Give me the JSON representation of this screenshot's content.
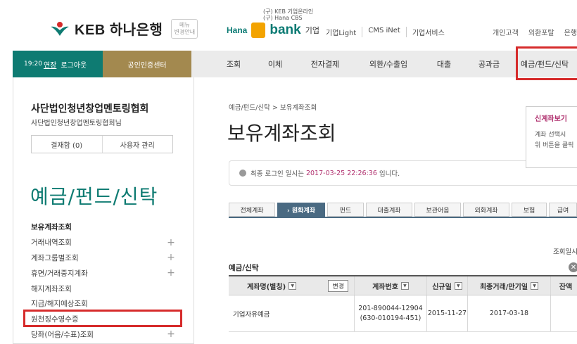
{
  "header": {
    "logo_text": "KEB 하나은행",
    "logo_badge": "메뉴\n변경안내",
    "hanabank": {
      "small_line1": "(구) KEB 기업온라인",
      "small_line2": "(구) Hana CBS",
      "hana": "Hana",
      "bank": "bank",
      "corp": "기업"
    },
    "links": [
      "기업Light",
      "CMS iNet",
      "기업서비스"
    ],
    "right_links": [
      "개인고객",
      "외환포탈",
      "은행"
    ]
  },
  "nav": {
    "time": "19:20",
    "extend": "연장",
    "logout": "로그아웃",
    "cert_center": "공인인증센터",
    "items": [
      "조회",
      "이체",
      "전자결제",
      "외환/수출입",
      "대출",
      "공과금",
      "예금/펀드/신탁"
    ]
  },
  "sidebar": {
    "org_name": "사단법인청년창업멘토링협회",
    "org_sub": "사단법인청년창업멘토링협회님",
    "approval_btn": "결재함 (0)",
    "user_mgmt_btn": "사용자 관리",
    "section_title": "예금/펀드/신탁",
    "menu": [
      {
        "label": "보유계좌조회",
        "plus": ""
      },
      {
        "label": "거래내역조회",
        "plus": "+"
      },
      {
        "label": "계좌그룹별조회",
        "plus": "+"
      },
      {
        "label": "휴면/거래중지계좌",
        "plus": "+"
      },
      {
        "label": "해지계좌조회",
        "plus": ""
      },
      {
        "label": "지급/해지예상조회",
        "plus": ""
      },
      {
        "label": "원천징수영수증",
        "plus": ""
      },
      {
        "label": "당좌(어음/수표)조회",
        "plus": "+"
      }
    ]
  },
  "main": {
    "breadcrumb": "예금/펀드/신탁  >  보유계좌조회",
    "title": "보유계좌조회",
    "login_prefix": "최종 로그인 일시는",
    "login_datetime": "2017-03-25 22:26:36",
    "login_suffix": "입니다.",
    "popup_title": "신계좌보기",
    "popup_line1": "계좌 선택시",
    "popup_line2": "위 버튼을 클릭",
    "tabs": [
      "전체계좌",
      "› 원화계좌",
      "펀드",
      "대출계좌",
      "보관어음",
      "외화계좌",
      "보험",
      "급여"
    ],
    "inquiry_date": "조회일시",
    "group_title": "예금/신탁",
    "table": {
      "headers": [
        "계좌명(별칭)",
        "계좌번호",
        "신규일",
        "최종거래/만기일",
        "잔액"
      ],
      "change_btn": "변경",
      "rows": [
        {
          "name": "기업자유예금",
          "acct1": "201-890044-12904",
          "acct2": "(630-010194-451)",
          "open": "2015-11-27",
          "last": "2017-03-18",
          "bal": ""
        }
      ]
    }
  }
}
